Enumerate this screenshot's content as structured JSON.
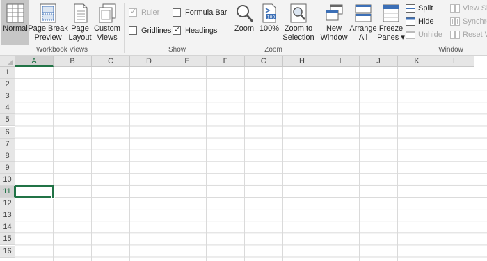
{
  "ribbon": {
    "workbook_views": {
      "label": "Workbook Views",
      "normal": "Normal",
      "page_break_preview": [
        "Page Break",
        "Preview"
      ],
      "page_layout": [
        "Page",
        "Layout"
      ],
      "custom_views": [
        "Custom",
        "Views"
      ]
    },
    "show": {
      "label": "Show",
      "ruler": "Ruler",
      "formula_bar": "Formula Bar",
      "gridlines": "Gridlines",
      "headings": "Headings"
    },
    "zoom": {
      "label": "Zoom",
      "zoom": "Zoom",
      "hundred": "100%",
      "zoom_to_selection": [
        "Zoom to",
        "Selection"
      ]
    },
    "window": {
      "label": "Window",
      "new_window": [
        "New",
        "Window"
      ],
      "arrange_all": [
        "Arrange",
        "All"
      ],
      "freeze_panes": [
        "Freeze",
        "Panes ▾"
      ],
      "split": "Split",
      "hide": "Hide",
      "unhide": "Unhide",
      "view_side": "View Sid",
      "synchro": "Synchro",
      "reset_w": "Reset W"
    }
  },
  "grid": {
    "columns": [
      "A",
      "B",
      "C",
      "D",
      "E",
      "F",
      "G",
      "H",
      "I",
      "J",
      "K",
      "L"
    ],
    "rows": [
      "1",
      "2",
      "3",
      "4",
      "5",
      "6",
      "7",
      "8",
      "9",
      "10",
      "11",
      "12",
      "13",
      "14",
      "15",
      "16"
    ],
    "active_column": "A",
    "active_row": "11"
  },
  "colors": {
    "accent": "#217346",
    "ribbon_bg": "#f3f3f3",
    "header_bg": "#e6e6e6",
    "selected_button": "#c6c6c6"
  }
}
